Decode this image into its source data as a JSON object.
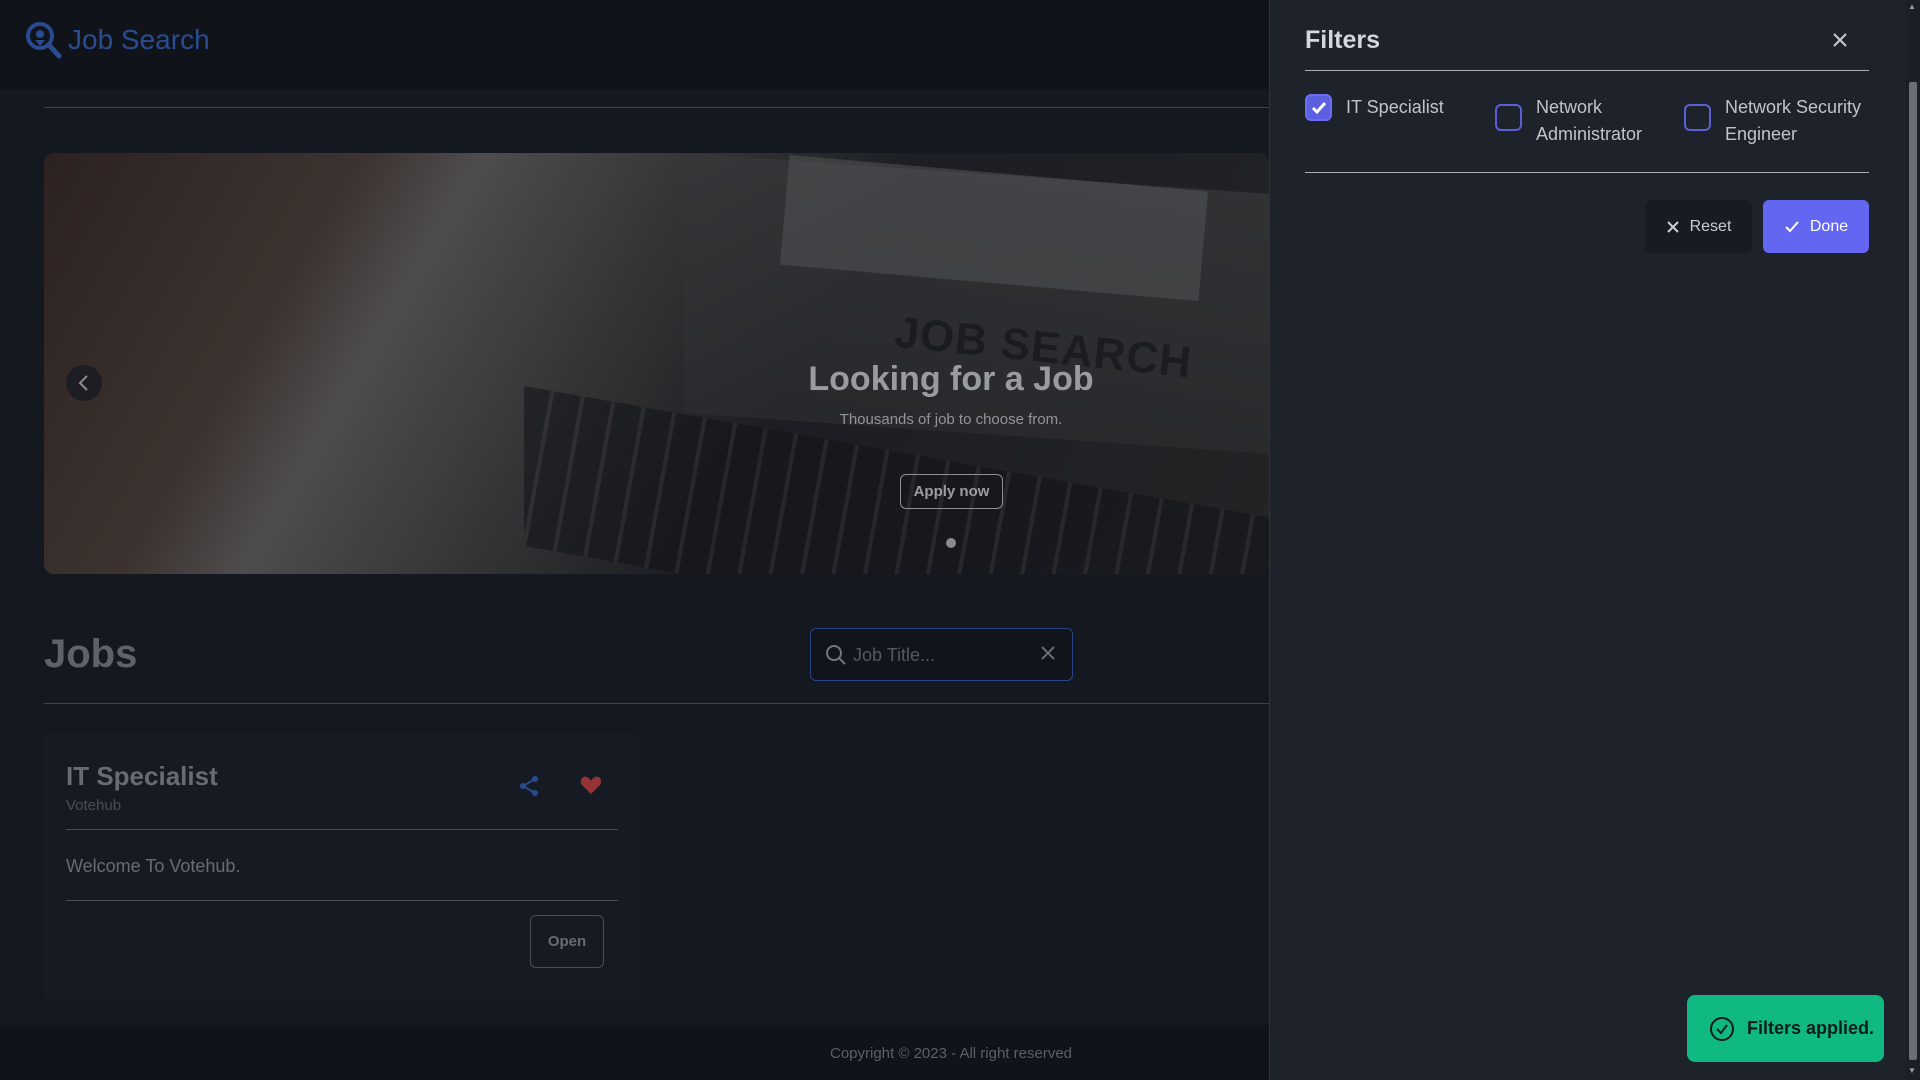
{
  "header": {
    "brand": "Job Search"
  },
  "hero": {
    "title": "Looking for a Job",
    "subtitle": "Thousands of job to choose from.",
    "cta": "Apply now",
    "image_text": "JOB SEARCH"
  },
  "jobs": {
    "title": "Jobs",
    "search": {
      "placeholder": "Job Title...",
      "value": ""
    },
    "cards": [
      {
        "title": "IT Specialist",
        "company": "Votehub",
        "description": "Welcome To Votehub.",
        "open_label": "Open"
      }
    ]
  },
  "footer": {
    "text": "Copyright © 2023 - All right reserved"
  },
  "filters": {
    "title": "Filters",
    "options": [
      {
        "label_line1": "IT Specialist",
        "label_line2": "",
        "checked": true
      },
      {
        "label_line1": "Network",
        "label_line2": "Administrator",
        "checked": false
      },
      {
        "label_line1": "Network Security",
        "label_line2": "Engineer",
        "checked": false
      }
    ],
    "reset_label": "Reset",
    "done_label": "Done"
  },
  "toast": {
    "text": "Filters applied."
  },
  "colors": {
    "accent": "#6366f1",
    "brand": "#3b6fd4",
    "success": "#10b981",
    "favorite": "#e0484e"
  },
  "icons": [
    "search-location-icon",
    "chevron-left-icon",
    "search-icon",
    "close-icon",
    "share-icon",
    "heart-icon",
    "check-icon",
    "check-circle-icon"
  ]
}
